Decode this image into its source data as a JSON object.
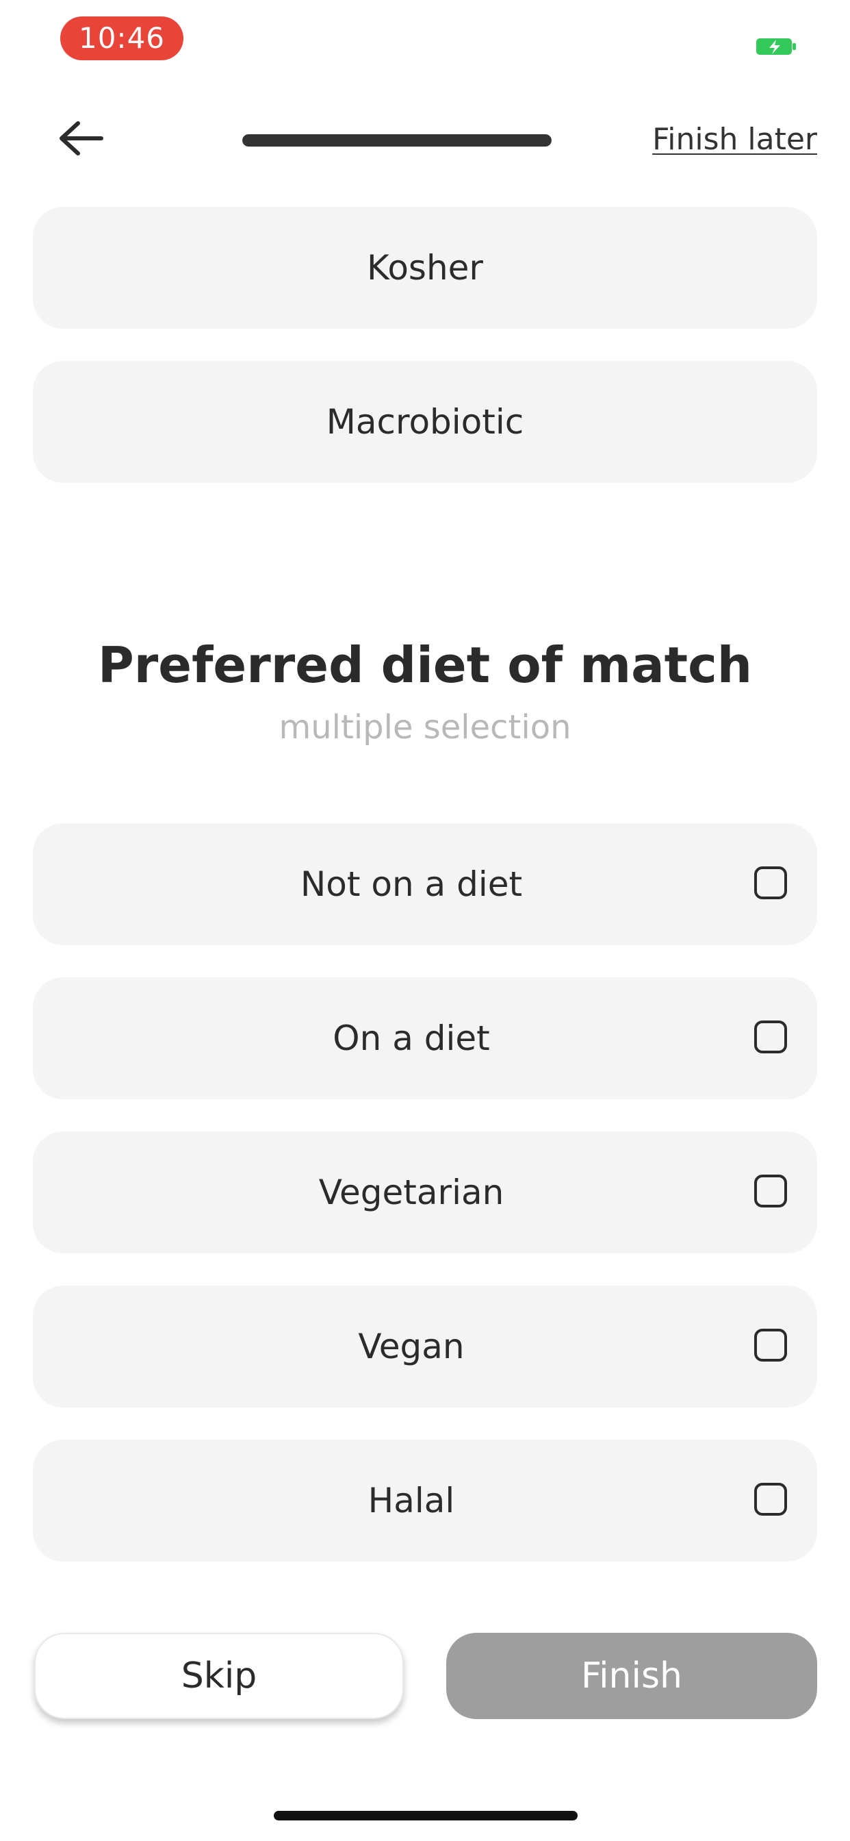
{
  "status_bar": {
    "time": "10:46",
    "time_pill_color": "#e9443a",
    "battery_color": "#34c759",
    "battery_icon": "battery-charging-icon"
  },
  "header": {
    "back_icon": "arrow-left-icon",
    "progress_fraction": 1.0,
    "finish_later_label": "Finish later"
  },
  "previous_options": [
    {
      "label": "Kosher"
    },
    {
      "label": "Macrobiotic"
    }
  ],
  "section": {
    "title": "Preferred diet of match",
    "subtitle": "multiple selection"
  },
  "options": [
    {
      "label": "Not on a diet",
      "checked": false
    },
    {
      "label": "On a diet",
      "checked": false
    },
    {
      "label": "Vegetarian",
      "checked": false
    },
    {
      "label": "Vegan",
      "checked": false
    },
    {
      "label": "Halal",
      "checked": false
    }
  ],
  "footer": {
    "skip_label": "Skip",
    "finish_label": "Finish",
    "finish_color": "#9e9e9e"
  }
}
